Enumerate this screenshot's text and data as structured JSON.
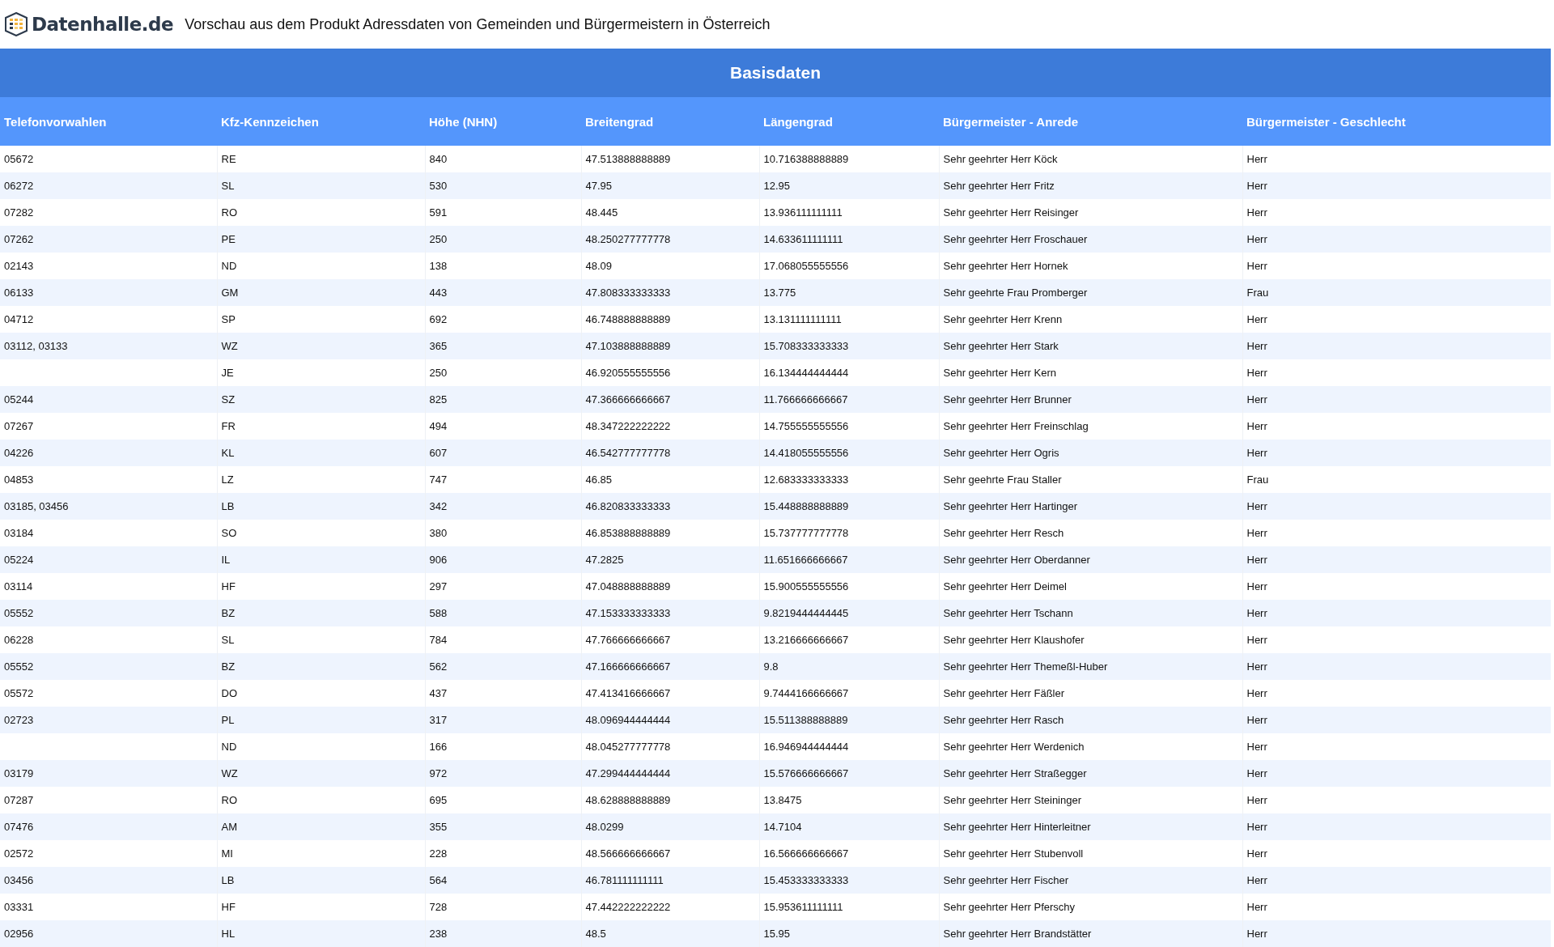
{
  "header": {
    "logo_text": "Datenhalle.de",
    "title": "Vorschau aus dem Produkt Adressdaten von Gemeinden und Bürgermeistern in Österreich"
  },
  "table": {
    "group_heading": "Basisdaten",
    "columns": [
      "Telefonvorwahlen",
      "Kfz-Kennzeichen",
      "Höhe (NHN)",
      "Breitengrad",
      "Längengrad",
      "Bürgermeister - Anrede",
      "Bürgermeister - Geschlecht"
    ],
    "rows": [
      [
        "05672",
        "RE",
        "840",
        "47.513888888889",
        "10.716388888889",
        "Sehr geehrter Herr Köck",
        "Herr"
      ],
      [
        "06272",
        "SL",
        "530",
        "47.95",
        "12.95",
        "Sehr geehrter Herr Fritz",
        "Herr"
      ],
      [
        "07282",
        "RO",
        "591",
        "48.445",
        "13.936111111111",
        "Sehr geehrter Herr Reisinger",
        "Herr"
      ],
      [
        "07262",
        "PE",
        "250",
        "48.250277777778",
        "14.633611111111",
        "Sehr geehrter Herr Froschauer",
        "Herr"
      ],
      [
        "02143",
        "ND",
        "138",
        "48.09",
        "17.068055555556",
        "Sehr geehrter Herr Hornek",
        "Herr"
      ],
      [
        "06133",
        "GM",
        "443",
        "47.808333333333",
        "13.775",
        "Sehr geehrte Frau Promberger",
        "Frau"
      ],
      [
        "04712",
        "SP",
        "692",
        "46.748888888889",
        "13.131111111111",
        "Sehr geehrter Herr Krenn",
        "Herr"
      ],
      [
        "03112, 03133",
        "WZ",
        "365",
        "47.103888888889",
        "15.708333333333",
        "Sehr geehrter Herr Stark",
        "Herr"
      ],
      [
        "",
        "JE",
        "250",
        "46.920555555556",
        "16.134444444444",
        "Sehr geehrter Herr Kern",
        "Herr"
      ],
      [
        "05244",
        "SZ",
        "825",
        "47.366666666667",
        "11.766666666667",
        "Sehr geehrter Herr Brunner",
        "Herr"
      ],
      [
        "07267",
        "FR",
        "494",
        "48.347222222222",
        "14.755555555556",
        "Sehr geehrter Herr Freinschlag",
        "Herr"
      ],
      [
        "04226",
        "KL",
        "607",
        "46.542777777778",
        "14.418055555556",
        "Sehr geehrter Herr Ogris",
        "Herr"
      ],
      [
        "04853",
        "LZ",
        "747",
        "46.85",
        "12.683333333333",
        "Sehr geehrte Frau Staller",
        "Frau"
      ],
      [
        "03185, 03456",
        "LB",
        "342",
        "46.820833333333",
        "15.448888888889",
        "Sehr geehrter Herr Hartinger",
        "Herr"
      ],
      [
        "03184",
        "SO",
        "380",
        "46.853888888889",
        "15.737777777778",
        "Sehr geehrter Herr Resch",
        "Herr"
      ],
      [
        "05224",
        "IL",
        "906",
        "47.2825",
        "11.651666666667",
        "Sehr geehrter Herr Oberdanner",
        "Herr"
      ],
      [
        "03114",
        "HF",
        "297",
        "47.048888888889",
        "15.900555555556",
        "Sehr geehrter Herr Deimel",
        "Herr"
      ],
      [
        "05552",
        "BZ",
        "588",
        "47.153333333333",
        "9.8219444444445",
        "Sehr geehrter Herr Tschann",
        "Herr"
      ],
      [
        "06228",
        "SL",
        "784",
        "47.766666666667",
        "13.216666666667",
        "Sehr geehrter Herr Klaushofer",
        "Herr"
      ],
      [
        "05552",
        "BZ",
        "562",
        "47.166666666667",
        "9.8",
        "Sehr geehrter Herr Themeßl-Huber",
        "Herr"
      ],
      [
        "05572",
        "DO",
        "437",
        "47.413416666667",
        "9.7444166666667",
        "Sehr geehrter Herr Fäßler",
        "Herr"
      ],
      [
        "02723",
        "PL",
        "317",
        "48.096944444444",
        "15.511388888889",
        "Sehr geehrter Herr Rasch",
        "Herr"
      ],
      [
        "",
        "ND",
        "166",
        "48.045277777778",
        "16.946944444444",
        "Sehr geehrter Herr Werdenich",
        "Herr"
      ],
      [
        "03179",
        "WZ",
        "972",
        "47.299444444444",
        "15.576666666667",
        "Sehr geehrter Herr Straßegger",
        "Herr"
      ],
      [
        "07287",
        "RO",
        "695",
        "48.628888888889",
        "13.8475",
        "Sehr geehrter Herr Steininger",
        "Herr"
      ],
      [
        "07476",
        "AM",
        "355",
        "48.0299",
        "14.7104",
        "Sehr geehrter Herr Hinterleitner",
        "Herr"
      ],
      [
        "02572",
        "MI",
        "228",
        "48.566666666667",
        "16.566666666667",
        "Sehr geehrter Herr Stubenvoll",
        "Herr"
      ],
      [
        "03456",
        "LB",
        "564",
        "46.781111111111",
        "15.453333333333",
        "Sehr geehrter Herr Fischer",
        "Herr"
      ],
      [
        "03331",
        "HF",
        "728",
        "47.442222222222",
        "15.953611111111",
        "Sehr geehrter Herr Pferschy",
        "Herr"
      ],
      [
        "02956",
        "HL",
        "238",
        "48.5",
        "15.95",
        "Sehr geehrter Herr Brandstätter",
        "Herr"
      ]
    ]
  }
}
